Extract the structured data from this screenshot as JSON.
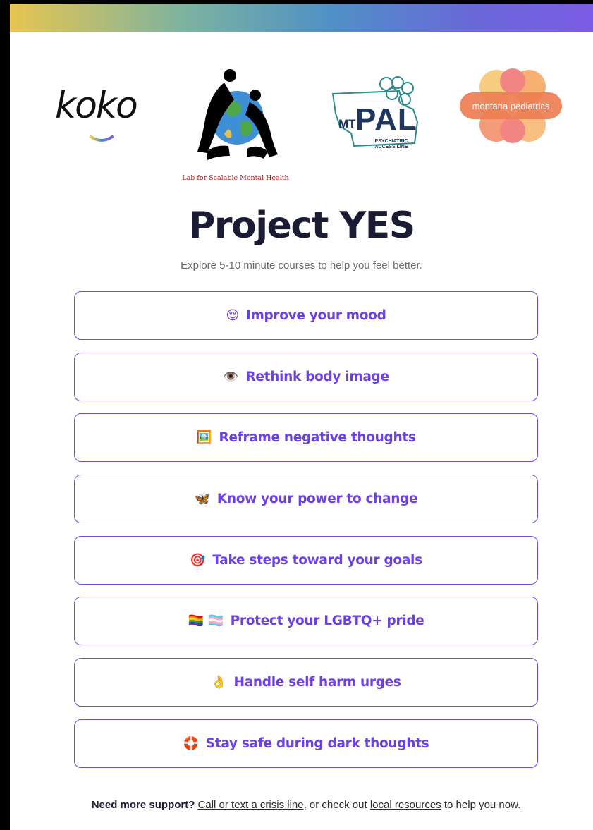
{
  "theme": {
    "accent": "#6c40e6",
    "title_color": "#1c1b34",
    "gradient": [
      "#e8c54f",
      "#4f91c6",
      "#7a5be6"
    ]
  },
  "logos": {
    "koko": {
      "text": "koko"
    },
    "lab": {
      "caption": "Lab for Scalable Mental Health"
    },
    "mtpal": {
      "prefix": "MT",
      "name": "PAL",
      "sub1": "PSYCHIATRIC",
      "sub2": "ACCESS LINE"
    },
    "montana": {
      "text": "montana pediatrics"
    }
  },
  "header": {
    "title": "Project YES",
    "subtitle": "Explore 5-10 minute courses to help you feel better."
  },
  "courses": [
    {
      "emoji": "😌",
      "label": "Improve your mood",
      "icon": "relieved-face-icon"
    },
    {
      "emoji": "👁️",
      "label": "Rethink body image",
      "icon": "eye-icon"
    },
    {
      "emoji": "🖼️",
      "label": "Reframe negative thoughts",
      "icon": "framed-picture-icon"
    },
    {
      "emoji": "🦋",
      "label": "Know your power to change",
      "icon": "butterfly-icon"
    },
    {
      "emoji": "🎯",
      "label": "Take steps toward your goals",
      "icon": "target-icon"
    },
    {
      "emoji": "🏳️‍🌈 🏳️‍⚧️",
      "label": "Protect your LGBTQ+ pride",
      "icon": "pride-flags-icon"
    },
    {
      "emoji": "👌",
      "label": "Handle self harm urges",
      "icon": "ok-hand-icon"
    },
    {
      "emoji": "🛟",
      "label": "Stay safe during dark thoughts",
      "icon": "lifebuoy-icon"
    }
  ],
  "footer": {
    "lead": "Need more support?",
    "crisis_link": "Call or text a crisis line",
    "middle": ", or check out ",
    "resources_link": "local resources",
    "tail": " to help you now."
  }
}
